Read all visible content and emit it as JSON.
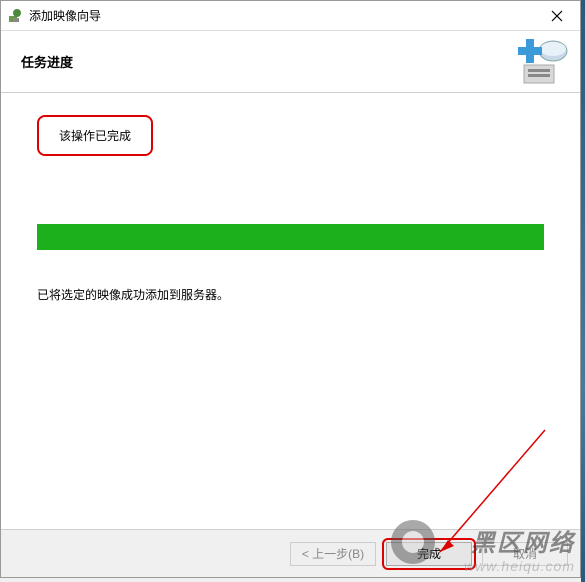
{
  "window": {
    "title": "添加映像向导"
  },
  "header": {
    "title": "任务进度"
  },
  "content": {
    "status": "该操作已完成",
    "message": "已将选定的映像成功添加到服务器。",
    "progress_percent": 100
  },
  "buttons": {
    "back": "< 上一步(B)",
    "finish": "完成",
    "cancel": "取消"
  },
  "watermark": {
    "title": "黑区网络",
    "url": "www.heiqu.com"
  }
}
